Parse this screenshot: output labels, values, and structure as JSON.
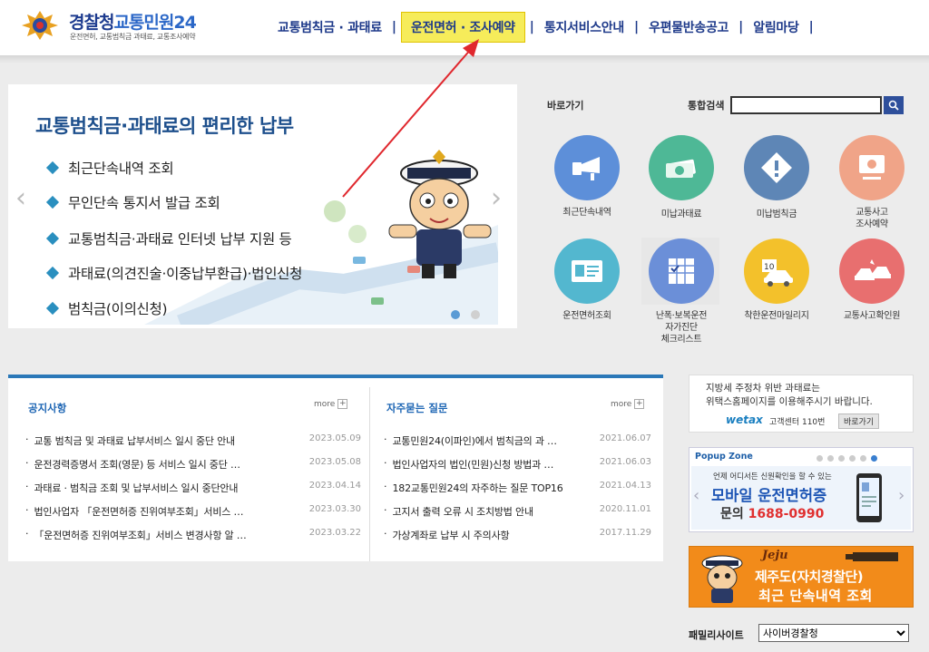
{
  "header": {
    "title_a": "경찰청",
    "title_b": "교통민원24",
    "subtitle": "운전면허, 교통범칙금 과태료, 교통조사예약",
    "nav": [
      "교통범칙금 · 과태료",
      "운전면허 · 조사예약",
      "통지서비스안내",
      "우편물반송공고",
      "알림마당"
    ],
    "nav_sep": "|"
  },
  "banner": {
    "title": "교통범칙금·과태료의 편리한 납부",
    "items": [
      "최근단속내역 조회",
      "무인단속 통지서 발급 조회",
      "교통범칙금·과태료 인터넷 납부 지원 등",
      "과태료(의견진술·이중납부환급)·법인신청",
      "범칙금(이의신청)"
    ]
  },
  "quick": {
    "label": "바로가기",
    "search_label": "통합검색",
    "items": [
      {
        "label": "최근단속내역",
        "color": "#5d8fd9",
        "icon": "cctv-icon"
      },
      {
        "label": "미납과태료",
        "color": "#4eb896",
        "icon": "money-icon"
      },
      {
        "label": "미납범칙금",
        "color": "#5e86b6",
        "icon": "warning-icon"
      },
      {
        "label": "교통사고\n조사예약",
        "color": "#f0a488",
        "icon": "computer-icon"
      },
      {
        "label": "운전면허조회",
        "color": "#53b7cf",
        "icon": "license-card-icon"
      },
      {
        "label": "난폭·보복운전\n자가진단\n체크리스트",
        "color": "#6b8fd8",
        "icon": "checklist-icon"
      },
      {
        "label": "착한운전마일리지",
        "color": "#f3c12b",
        "icon": "mileage-car-icon"
      },
      {
        "label": "교통사고확인원",
        "color": "#e86f6f",
        "icon": "car-crash-icon"
      }
    ]
  },
  "notice": {
    "title": "공지사항",
    "more": "more",
    "rows": [
      {
        "title": "교통 범칙금 및 과태료 납부서비스 일시 중단 안내",
        "date": "2023.05.09"
      },
      {
        "title": "운전경력증명서 조회(영문) 등 서비스 일시 중단 …",
        "date": "2023.05.08"
      },
      {
        "title": "과태료 · 범칙금 조회 및 납부서비스 일시 중단안내",
        "date": "2023.04.14"
      },
      {
        "title": "법인사업자 「운전면허증 진위여부조회」서비스 …",
        "date": "2023.03.30"
      },
      {
        "title": "「운전면허증 진위여부조회」서비스 변경사항 알 …",
        "date": "2023.03.22"
      }
    ]
  },
  "faq": {
    "title": "자주묻는 질문",
    "more": "more",
    "rows": [
      {
        "title": "교통민원24(이파인)에서 범칙금의 과 …",
        "date": "2021.06.07"
      },
      {
        "title": "법인사업자의 법인(민원)신청 방법과 …",
        "date": "2021.06.03"
      },
      {
        "title": "182교통민원24의 자주하는 질문 TOP16",
        "date": "2021.04.13"
      },
      {
        "title": "고지서 출력 오류 시 조치방법 안내",
        "date": "2020.11.01"
      },
      {
        "title": "가상계좌로 납부 시 주의사항",
        "date": "2017.11.29"
      }
    ]
  },
  "ads": {
    "wetax_line1": "지방세 주정차 위반 과태료는",
    "wetax_line2": "위택스홈페이지를 이용해주시기 바랍니다.",
    "wetax_brand": "wetax",
    "wetax_center": "고객센터 110번",
    "wetax_btn": "바로가기",
    "popup_zone": "Popup Zone",
    "popup_small": "언제 어디서든 신원확인을 할 수 있는",
    "popup_main": "모바일 운전면허증",
    "popup_inquiry": "문의",
    "popup_phone": "1688-0990",
    "jeju_brand": "Jeju",
    "jeju_line1": "제주도(자치경찰단)",
    "jeju_line2": "최근 단속내역 조회"
  },
  "family": {
    "label": "패밀리사이트",
    "selected": "사이버경찰청"
  }
}
